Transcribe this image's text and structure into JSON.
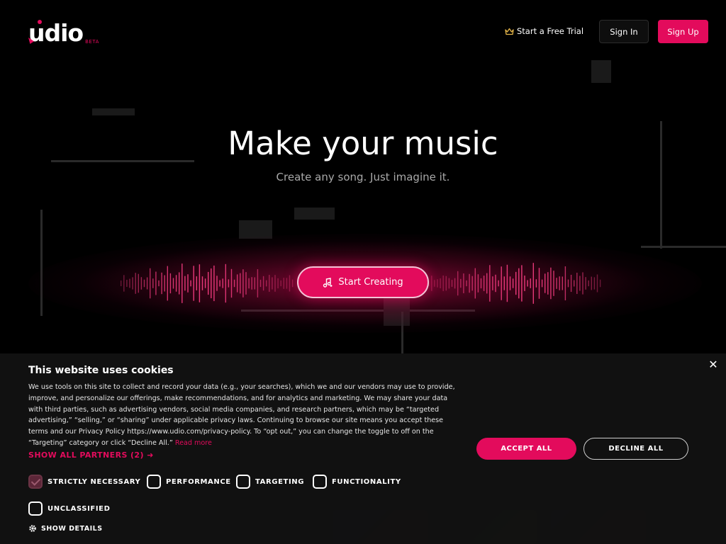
{
  "header": {
    "logo_text": "udio",
    "logo_badge": "BETA",
    "trial_label": "Start a Free Trial",
    "signin_label": "Sign In",
    "signup_label": "Sign Up"
  },
  "hero": {
    "title": "Make your music",
    "subtitle": "Create any song. Just imagine it.",
    "cta_label": "Start Creating"
  },
  "cookie_banner": {
    "title": "This website uses cookies",
    "body": "We use tools on this site to collect and record your data (e.g., your searches), which we and our vendors may use to provide, improve, and personalize our offerings, make recommendations, and for analytics and marketing. We may share your data with third parties, such as advertising vendors, social media companies, and research partners, which may be “targeted advertising,” “selling,” or “sharing” under applicable privacy laws. Continuing to browse our site means you accept these terms and our Privacy Policy https://www.udio.com/privacy-policy. To “opt out,” you can change the toggle to off on the “Targeting” category or click “Decline All.”",
    "read_more": "Read more",
    "show_partners": "SHOW ALL PARTNERS (2)",
    "accept_label": "ACCEPT ALL",
    "decline_label": "DECLINE ALL",
    "close_symbol": "✕",
    "categories": [
      {
        "label": "STRICTLY NECESSARY",
        "checked": true
      },
      {
        "label": "PERFORMANCE",
        "checked": false
      },
      {
        "label": "TARGETING",
        "checked": false
      },
      {
        "label": "FUNCTIONALITY",
        "checked": false
      },
      {
        "label": "UNCLASSIFIED",
        "checked": false
      }
    ],
    "show_details": "SHOW DETAILS"
  },
  "colors": {
    "accent": "#e30b5c",
    "background": "#000000",
    "banner": "#121212"
  },
  "icons": {
    "crown": "crown-icon",
    "music_note": "music-note-icon",
    "gear": "gear-icon",
    "close": "close-icon",
    "arrow": "arrow-right-icon"
  }
}
